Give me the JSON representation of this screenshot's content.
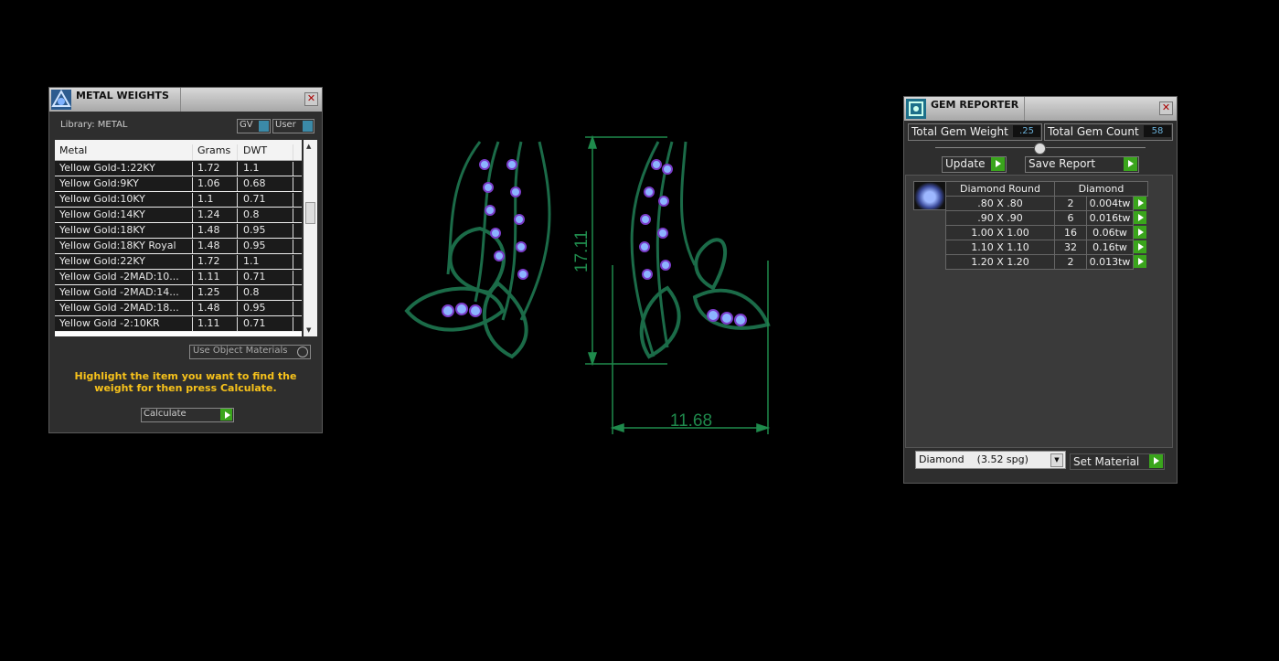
{
  "metal_weights": {
    "title": "METAL WEIGHTS",
    "library_label": "Library: METAL",
    "toggle_gv": "GV",
    "toggle_user": "User",
    "columns": [
      "Metal",
      "Grams",
      "DWT"
    ],
    "rows": [
      {
        "metal": "Yellow Gold-1:22KY",
        "grams": "1.72",
        "dwt": "1.1"
      },
      {
        "metal": "Yellow Gold:9KY",
        "grams": "1.06",
        "dwt": "0.68"
      },
      {
        "metal": "Yellow Gold:10KY",
        "grams": "1.1",
        "dwt": "0.71"
      },
      {
        "metal": "Yellow Gold:14KY",
        "grams": "1.24",
        "dwt": "0.8"
      },
      {
        "metal": "Yellow Gold:18KY",
        "grams": "1.48",
        "dwt": "0.95"
      },
      {
        "metal": "Yellow Gold:18KY Royal",
        "grams": "1.48",
        "dwt": "0.95"
      },
      {
        "metal": "Yellow Gold:22KY",
        "grams": "1.72",
        "dwt": "1.1"
      },
      {
        "metal": "Yellow Gold -2MAD:10...",
        "grams": "1.11",
        "dwt": "0.71"
      },
      {
        "metal": "Yellow Gold -2MAD:14...",
        "grams": "1.25",
        "dwt": "0.8"
      },
      {
        "metal": "Yellow Gold -2MAD:18...",
        "grams": "1.48",
        "dwt": "0.95"
      },
      {
        "metal": "Yellow Gold -2:10KR",
        "grams": "1.11",
        "dwt": "0.71"
      }
    ],
    "use_object_materials": "Use Object Materials",
    "hint": "Highlight the item you want to find the weight for then press Calculate.",
    "calculate": "Calculate"
  },
  "gem_reporter": {
    "title": "GEM REPORTER",
    "total_weight_label": "Total Gem Weight",
    "total_weight_value": ".25",
    "total_count_label": "Total Gem Count",
    "total_count_value": "58",
    "update": "Update",
    "save_report": "Save Report",
    "table_headers": [
      "Diamond Round",
      "Diamond"
    ],
    "gems": [
      {
        "size": ".80 X .80",
        "count": "2",
        "weight": "0.004tw"
      },
      {
        "size": ".90 X .90",
        "count": "6",
        "weight": "0.016tw"
      },
      {
        "size": "1.00 X 1.00",
        "count": "16",
        "weight": "0.06tw"
      },
      {
        "size": "1.10 X 1.10",
        "count": "32",
        "weight": "0.16tw"
      },
      {
        "size": "1.20 X 1.20",
        "count": "2",
        "weight": "0.013tw"
      }
    ],
    "material_select": "Diamond    (3.52 spg)",
    "set_material": "Set Material"
  },
  "viewport": {
    "dim_height": "17.11",
    "dim_width": "11.68"
  },
  "colors": {
    "background": "#000000",
    "panel": "#2e2e2e",
    "hint_text": "#f7c21b",
    "dimension": "#1f8a4c",
    "gem": "#8cb4ff",
    "prong": "#7a3cc8",
    "metal": "#1b6b48"
  }
}
